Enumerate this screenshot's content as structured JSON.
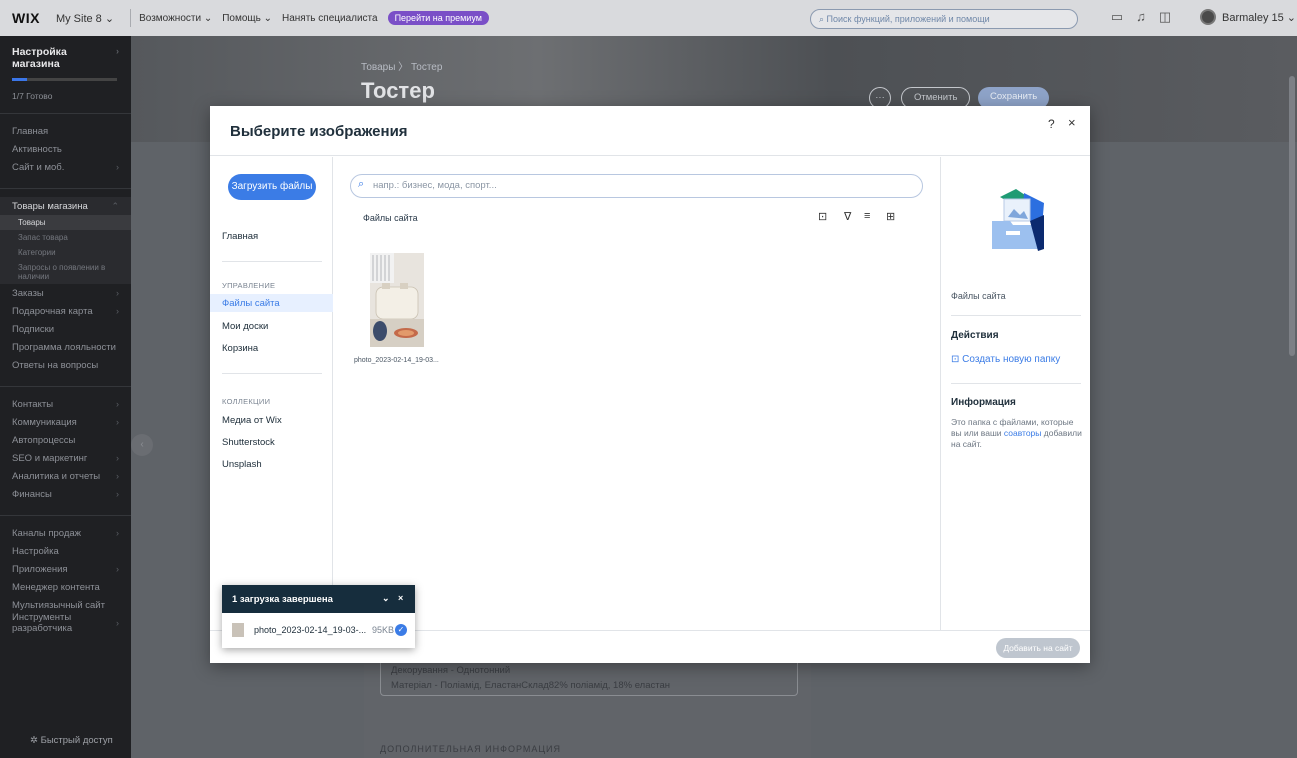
{
  "topbar": {
    "logo": "WIX",
    "site": "My Site 8 ⌄",
    "menus": [
      "Возможности ⌄",
      "Помощь ⌄",
      "Нанять специалиста"
    ],
    "premium_pill": "Перейти на премиум",
    "search_placeholder": "Поиск функций, приложений и помощи",
    "user": "Barmaley 15 ⌄"
  },
  "sidebar": {
    "setup_title": "Настройка магазина",
    "setup_progress": 0.14,
    "setup_ready": "1/7 Готово",
    "items_a": [
      {
        "label": "Главная",
        "arrow": ""
      },
      {
        "label": "Активность",
        "arrow": ""
      },
      {
        "label": "Сайт и моб.",
        "arrow": "›"
      }
    ],
    "store_products": "Товары магазина",
    "store_subitems": [
      "Товары",
      "Запас товара",
      "Категории",
      "Запросы о появлении в наличии"
    ],
    "items_b": [
      {
        "label": "Заказы",
        "arrow": "›"
      },
      {
        "label": "Подарочная карта",
        "arrow": "›"
      },
      {
        "label": "Подписки",
        "arrow": ""
      },
      {
        "label": "Программа лояльности",
        "arrow": ""
      },
      {
        "label": "Ответы на вопросы",
        "arrow": ""
      }
    ],
    "items_c": [
      {
        "label": "Контакты",
        "arrow": "›"
      },
      {
        "label": "Коммуникация",
        "arrow": "›"
      },
      {
        "label": "Автопроцессы",
        "arrow": ""
      },
      {
        "label": "SEO и маркетинг",
        "arrow": "›"
      },
      {
        "label": "Аналитика и отчеты",
        "arrow": "›"
      },
      {
        "label": "Финансы",
        "arrow": "›"
      }
    ],
    "items_d": [
      {
        "label": "Каналы продаж",
        "arrow": "›"
      },
      {
        "label": "Настройка",
        "arrow": ""
      },
      {
        "label": "Приложения",
        "arrow": "›"
      },
      {
        "label": "Менеджер контента",
        "arrow": ""
      },
      {
        "label": "Мультиязычный сайт",
        "arrow": ""
      },
      {
        "label": "Инструменты разработчика",
        "arrow": "›"
      }
    ],
    "quick_access": "Быстрый доступ"
  },
  "background": {
    "breadcrumb": "Товары  〉 Тостер",
    "title": "Тостер",
    "cancel": "Отменить",
    "save": "Сохранить",
    "desc_line1": "Декорування - Однотонний",
    "desc_line2": "Матеріал - Поліамід, ЕластанСклад82% поліамід, 18% еластан",
    "extra_info": "ДОПОЛНИТЕЛЬНАЯ ИНФОРМАЦИЯ"
  },
  "modal": {
    "title": "Выберите изображения",
    "help": "?",
    "close": "×",
    "upload_button": "Загрузить файлы",
    "left": {
      "home": "Главная",
      "section_manage": "УПРАВЛЕНИЕ",
      "site_files": "Файлы сайта",
      "my_boards": "Мои доски",
      "trash": "Корзина",
      "section_collections": "КОЛЛЕКЦИИ",
      "wix_media": "Медиа от Wix",
      "shutterstock": "Shutterstock",
      "unsplash": "Unsplash"
    },
    "search_placeholder": "напр.: бизнес, мода, спорт...",
    "files_label": "Файлы сайта",
    "file_caption": "photo_2023-02-14_19-03...",
    "right": {
      "folder_label": "Файлы сайта",
      "actions_title": "Действия",
      "new_folder": "Создать новую папку",
      "info_title": "Информация",
      "info_text_1": "Это папка с файлами, которые вы или ваши ",
      "info_link": "соавторы",
      "info_text_2": " добавили на сайт."
    },
    "add_button": "Добавить на сайт"
  },
  "toast": {
    "title": "1 загрузка завершена",
    "file_name": "photo_2023-02-14_19-03-...",
    "file_size": "95KB"
  }
}
